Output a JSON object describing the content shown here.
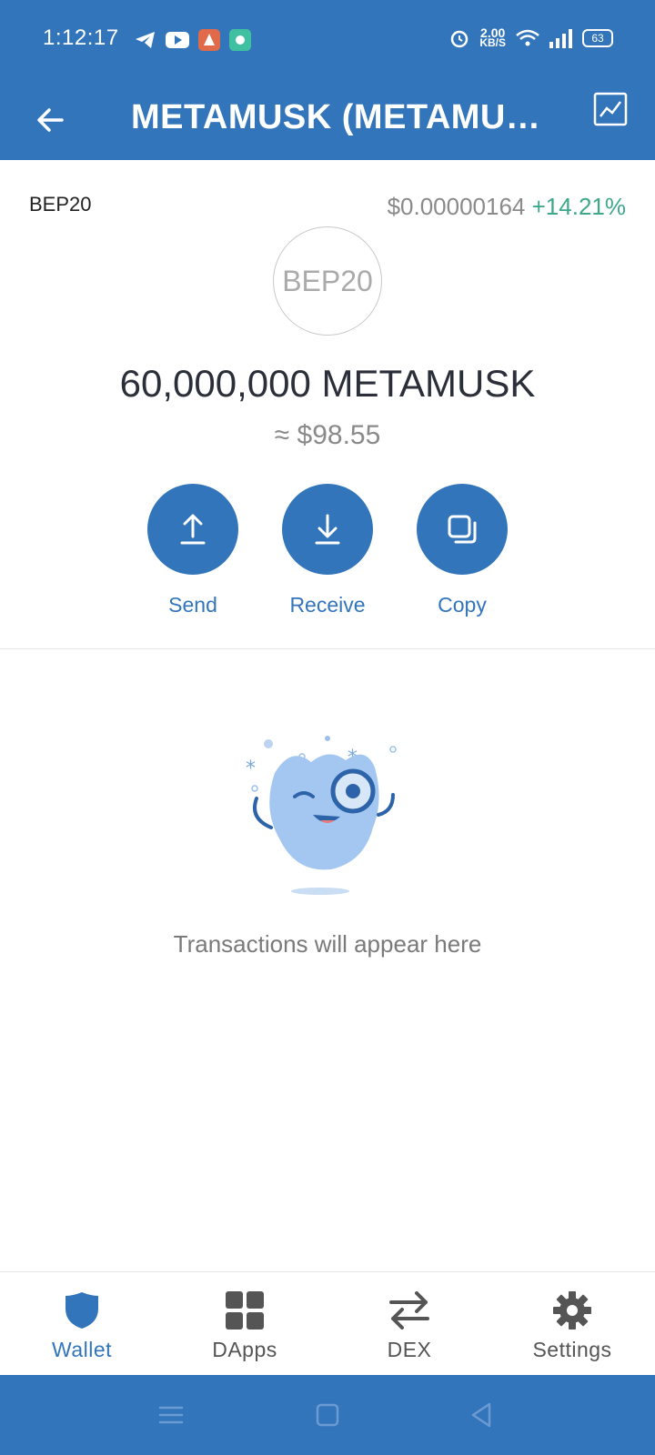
{
  "status_bar": {
    "time": "1:12:17",
    "net_speed_value": "2.00",
    "net_speed_unit": "KB/S",
    "battery": "63"
  },
  "header": {
    "title": "METAMUSK (METAMUSK)",
    "back_icon": "arrow-left-icon",
    "chart_icon": "line-chart-icon"
  },
  "token": {
    "network": "BEP20",
    "price": "$0.00000164",
    "change": "+14.21%",
    "logo_text": "BEP20",
    "balance": "60,000,000 METAMUSK",
    "fiat_value": "≈ $98.55"
  },
  "actions": [
    {
      "label": "Send",
      "icon": "upload-arrow-icon"
    },
    {
      "label": "Receive",
      "icon": "download-arrow-icon"
    },
    {
      "label": "Copy",
      "icon": "copy-icon"
    }
  ],
  "empty_state": {
    "message": "Transactions will appear here"
  },
  "tabs": [
    {
      "label": "Wallet",
      "icon": "shield-icon",
      "active": true
    },
    {
      "label": "DApps",
      "icon": "grid-icon",
      "active": false
    },
    {
      "label": "DEX",
      "icon": "swap-arrows-icon",
      "active": false
    },
    {
      "label": "Settings",
      "icon": "gear-icon",
      "active": false
    }
  ],
  "colors": {
    "brand": "#3375bb",
    "positive": "#3da88a"
  }
}
